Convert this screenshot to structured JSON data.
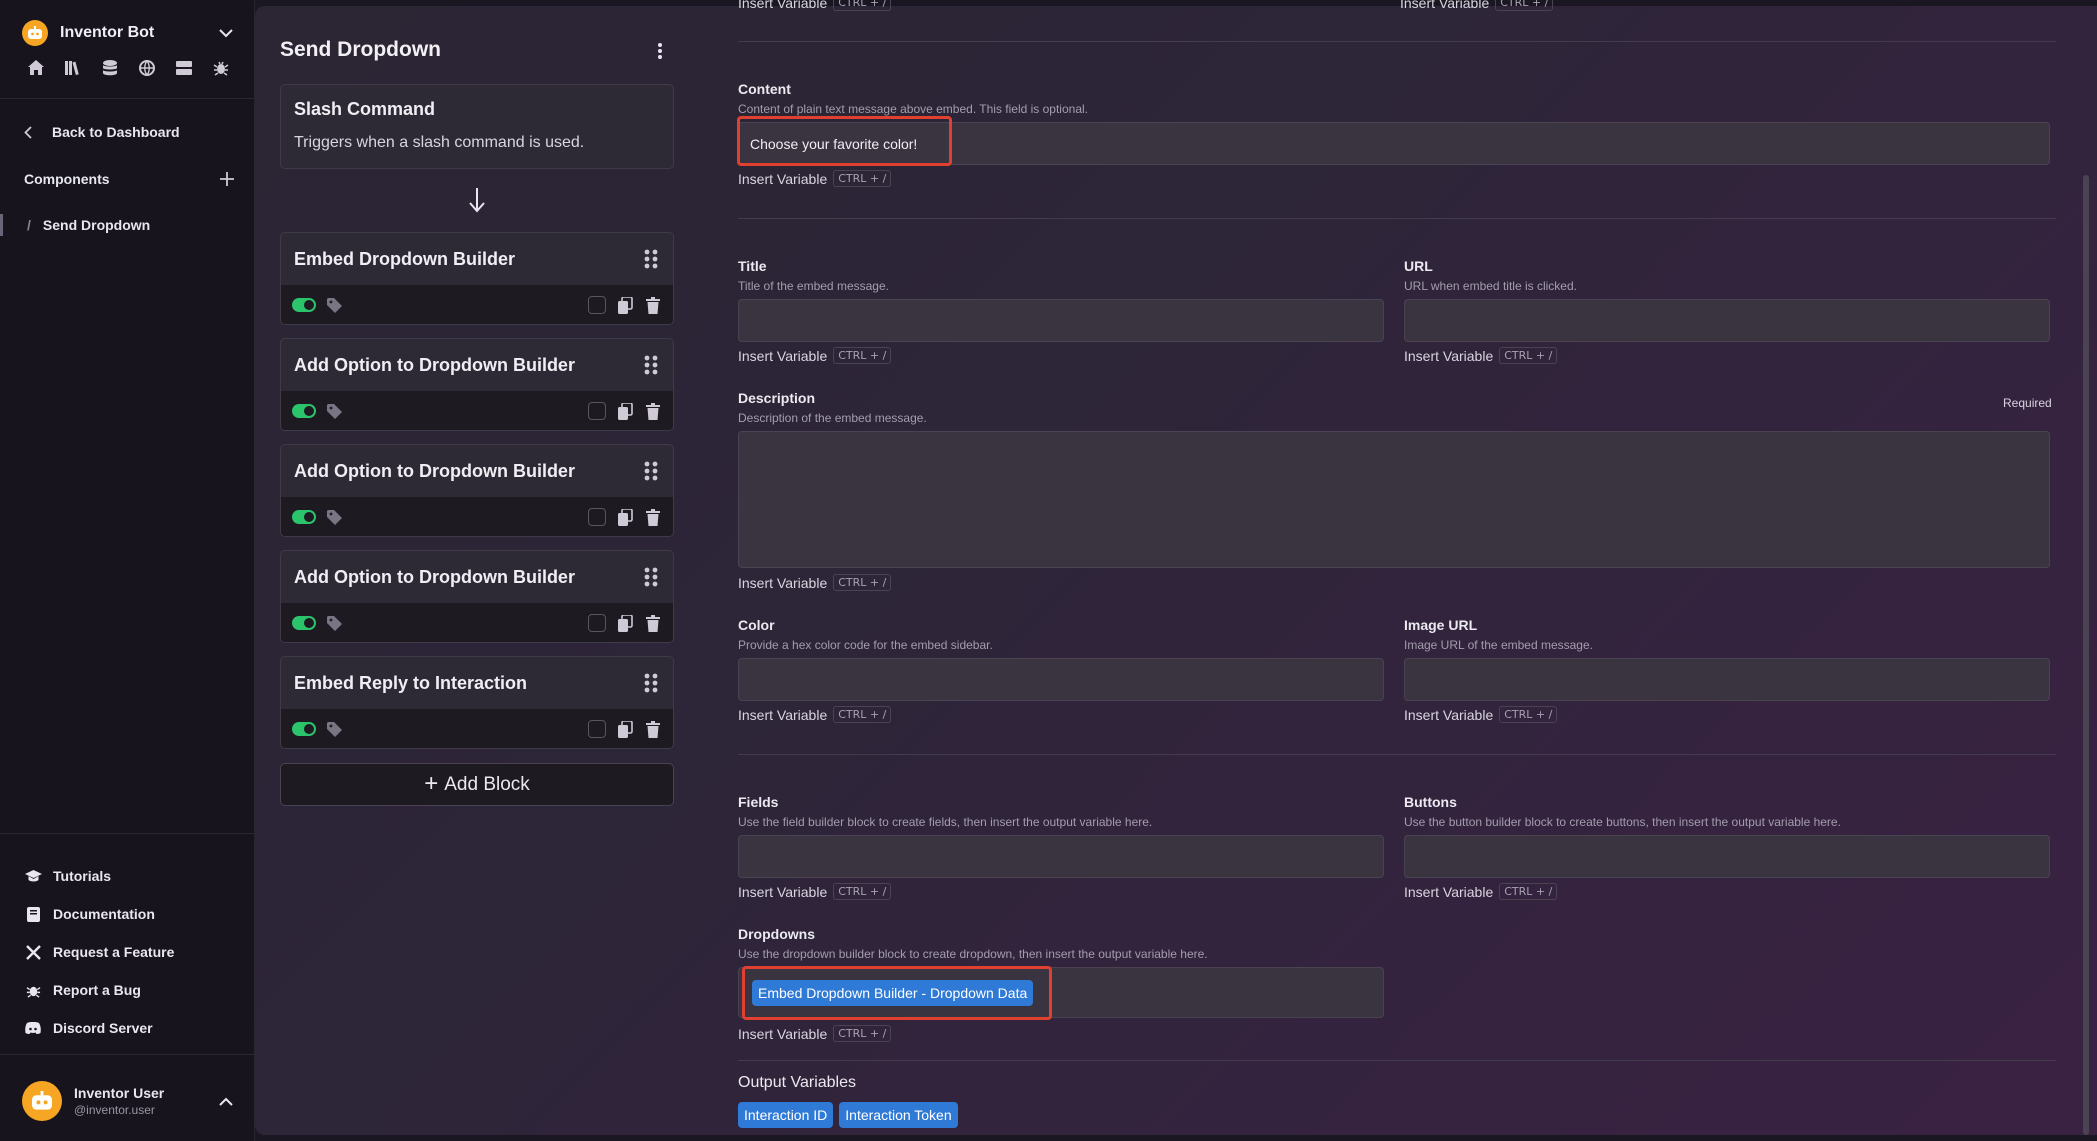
{
  "sidebar": {
    "bot_name": "Inventor Bot",
    "back_label": "Back to Dashboard",
    "components_label": "Components",
    "component_item": "Send Dropdown",
    "footer": [
      "Tutorials",
      "Documentation",
      "Request a Feature",
      "Report a Bug",
      "Discord Server"
    ],
    "user_name": "Inventor User",
    "user_handle": "@inventor.user"
  },
  "blocks": {
    "title": "Send Dropdown",
    "slash": {
      "title": "Slash Command",
      "desc": "Triggers when a slash command is used."
    },
    "items": [
      "Embed Dropdown Builder",
      "Add Option to Dropdown Builder",
      "Add Option to Dropdown Builder",
      "Add Option to Dropdown Builder",
      "Embed Reply to Interaction"
    ],
    "add_label": "Add Block"
  },
  "form": {
    "insert_variable": "Insert Variable",
    "shortcut": "CTRL + /",
    "content": {
      "label": "Content",
      "hint": "Content of plain text message above embed. This field is optional.",
      "value": "Choose your favorite color!"
    },
    "title": {
      "label": "Title",
      "hint": "Title of the embed message."
    },
    "url": {
      "label": "URL",
      "hint": "URL when embed title is clicked."
    },
    "description": {
      "label": "Description",
      "hint": "Description of the embed message.",
      "required": "Required"
    },
    "color": {
      "label": "Color",
      "hint": "Provide a hex color code for the embed sidebar."
    },
    "image_url": {
      "label": "Image URL",
      "hint": "Image URL of the embed message."
    },
    "fields": {
      "label": "Fields",
      "hint": "Use the field builder block to create fields, then insert the output variable here."
    },
    "buttons": {
      "label": "Buttons",
      "hint": "Use the button builder block to create buttons, then insert the output variable here."
    },
    "dropdowns": {
      "label": "Dropdowns",
      "hint": "Use the dropdown builder block to create dropdown, then insert the output variable here.",
      "chip": "Embed Dropdown Builder - Dropdown Data"
    },
    "output_title": "Output Variables",
    "outputs": [
      "Interaction ID",
      "Interaction Token"
    ]
  },
  "colors": {
    "accent": "#2f7ad6",
    "toggle_on": "#2bc46b",
    "highlight": "#e0402f",
    "avatar": "#f6a623"
  }
}
